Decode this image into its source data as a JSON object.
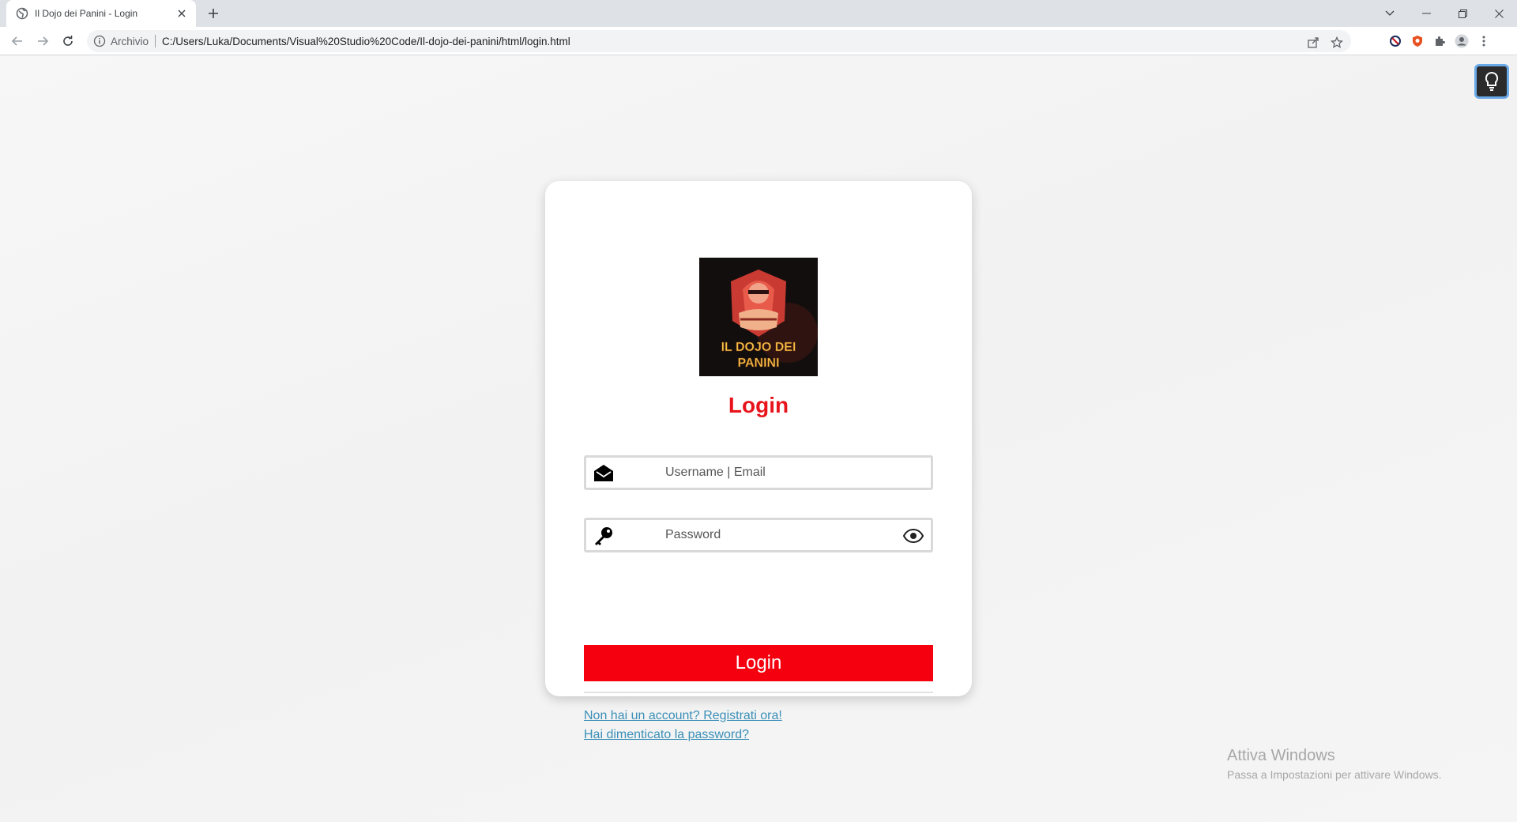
{
  "browser": {
    "tab_title": "Il Dojo dei Panini - Login",
    "omnibox_label": "Archivio",
    "url": "C:/Users/Luka/Documents/Visual%20Studio%20Code/Il-dojo-dei-panini/html/login.html"
  },
  "login": {
    "logo_text_line1": "IL DOJO DEI",
    "logo_text_line2": "PANINI",
    "title": "Login",
    "username_placeholder": "Username | Email",
    "password_placeholder": "Password",
    "submit_label": "Login",
    "register_link": "Non hai un account? Registrati ora!",
    "forgot_link": "Hai dimenticato la password?"
  },
  "watermark": {
    "title": "Attiva Windows",
    "subtitle": "Passa a Impostazioni per attivare Windows."
  },
  "colors": {
    "accent_red": "#f5000f",
    "title_red": "#e8141c",
    "link_blue": "#3a8fb7"
  }
}
